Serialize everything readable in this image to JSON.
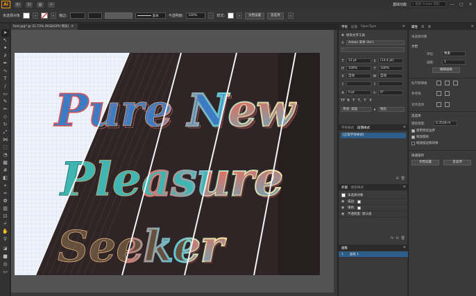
{
  "menubar": {
    "app_logo": "Ai",
    "menu_icons": [
      "Br",
      "St",
      "▦",
      "✈"
    ],
    "workspace": "基础功能",
    "search_placeholder": "搜索 Adobe 帮助",
    "window_controls": [
      "—",
      "▢",
      "✕"
    ]
  },
  "controlbar": {
    "selection_label": "未选择对象",
    "stroke_label": "描边:",
    "stroke_style": "基本",
    "opacity_label": "不透明度:",
    "opacity_value": "100%",
    "style_label": "样式:",
    "doc_setup_button": "文档设置",
    "preferences_button": "首选项"
  },
  "document": {
    "tab_title": "font.jpg* @ 31.73% (RGB/GPU 预览)",
    "close": "✕"
  },
  "artwork": {
    "line1": "Pure New",
    "line2": "Pleasure",
    "line3": "Seeker"
  },
  "character_panel": {
    "tabs": [
      "字符",
      "段落",
      "OpenType"
    ],
    "touch_type_tool": "修饰文字工具",
    "font_family": "Adobe 宋体 Std L",
    "font_style": "-",
    "font_size": "12 pt",
    "leading": "(14.4 pt)",
    "vertical_scale": "100%",
    "horizontal_scale": "100%",
    "kerning": "自动",
    "tracking": "自动",
    "baseline_shift": "0 pt",
    "rotation": "0°",
    "language": "英语: 美国",
    "antialias": "锐化",
    "glyph_buttons": [
      "TT",
      "Tr",
      "T'",
      "T,",
      "T",
      "Ŧ"
    ]
  },
  "paragraph_styles_panel": {
    "tabs": [
      "字符样式",
      "段落样式"
    ],
    "items": [
      "[正常字符样式]"
    ]
  },
  "appearance_panel": {
    "tabs": [
      "外观",
      "图形样式"
    ],
    "object_label": "未选择对象",
    "rows": [
      {
        "label": "描边:"
      },
      {
        "label": "填色:"
      },
      {
        "label": "不透明度: 默认值"
      }
    ]
  },
  "layers_panel": {
    "tabs": [
      "画板"
    ],
    "rows": [
      {
        "index": "1",
        "name": "画板 1"
      }
    ]
  },
  "properties_panel": {
    "tabs": [
      "属性",
      "库",
      "库"
    ],
    "no_selection": "未选择对象",
    "document_label": "文档",
    "unit_label": "单位:",
    "unit_value": "像素",
    "artboard_label": "画板:",
    "artboard_value": "1",
    "edit_artboard_button": "编辑画板",
    "rulers_grid_label": "标尺和网格",
    "guides_label": "参考线",
    "snap_label": "对齐选项",
    "preferences_label": "首选项",
    "keyboard_increment_label": "键盘增量:",
    "keyboard_increment_value": "0.3528 m",
    "checkboxes": [
      {
        "label": "使用预览边界",
        "checked": true
      },
      {
        "label": "缩放圆角",
        "checked": true
      },
      {
        "label": "缩放描边和效果",
        "checked": false
      }
    ],
    "quick_actions_label": "快速操作",
    "doc_setup_button": "文档设置",
    "preferences_button": "首选项"
  },
  "colors": {
    "app_bg": "#2b2b2b",
    "panel_bg": "#3a3a3a",
    "accent_orange": "#ff9a00",
    "selection_blue": "#2d5d8a",
    "art_dark": "#2f2426",
    "lettering_blue": "#3b7cc4",
    "lettering_coral": "#e55a5a",
    "lettering_teal": "#3fb6b2"
  }
}
